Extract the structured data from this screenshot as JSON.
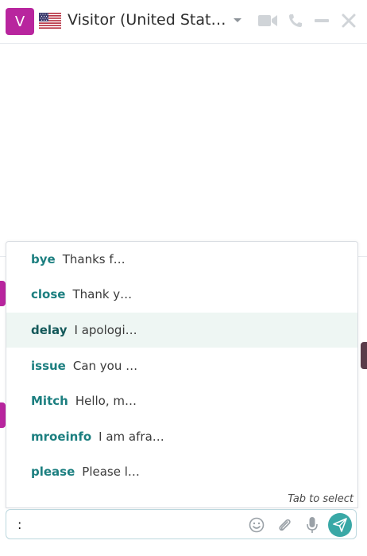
{
  "header": {
    "avatar_letter": "V",
    "title": "Visitor (United Stat…",
    "icons": [
      "chevron-down-icon",
      "video-camera-icon",
      "phone-icon",
      "minimize-icon",
      "close-icon"
    ]
  },
  "suggestions": {
    "items": [
      {
        "command": "bye",
        "text": "Thanks f…"
      },
      {
        "command": "close",
        "text": "Thank y…"
      },
      {
        "command": "delay",
        "text": "I apologi…"
      },
      {
        "command": "issue",
        "text": "Can you …"
      },
      {
        "command": "Mitch",
        "text": "Hello, m…"
      },
      {
        "command": "mroeinfo",
        "text": "I am afra…"
      },
      {
        "command": "please",
        "text": "Please l…"
      }
    ],
    "active_index": 2,
    "hint": "Tab to select"
  },
  "composer": {
    "value": ":",
    "icons": [
      "emoji-icon",
      "paperclip-icon",
      "microphone-icon",
      "send-icon"
    ]
  },
  "colors": {
    "avatar": "#b8259e",
    "accent": "#39a8a6",
    "command_text": "#1c7f80",
    "active_row": "#eef6f3"
  }
}
